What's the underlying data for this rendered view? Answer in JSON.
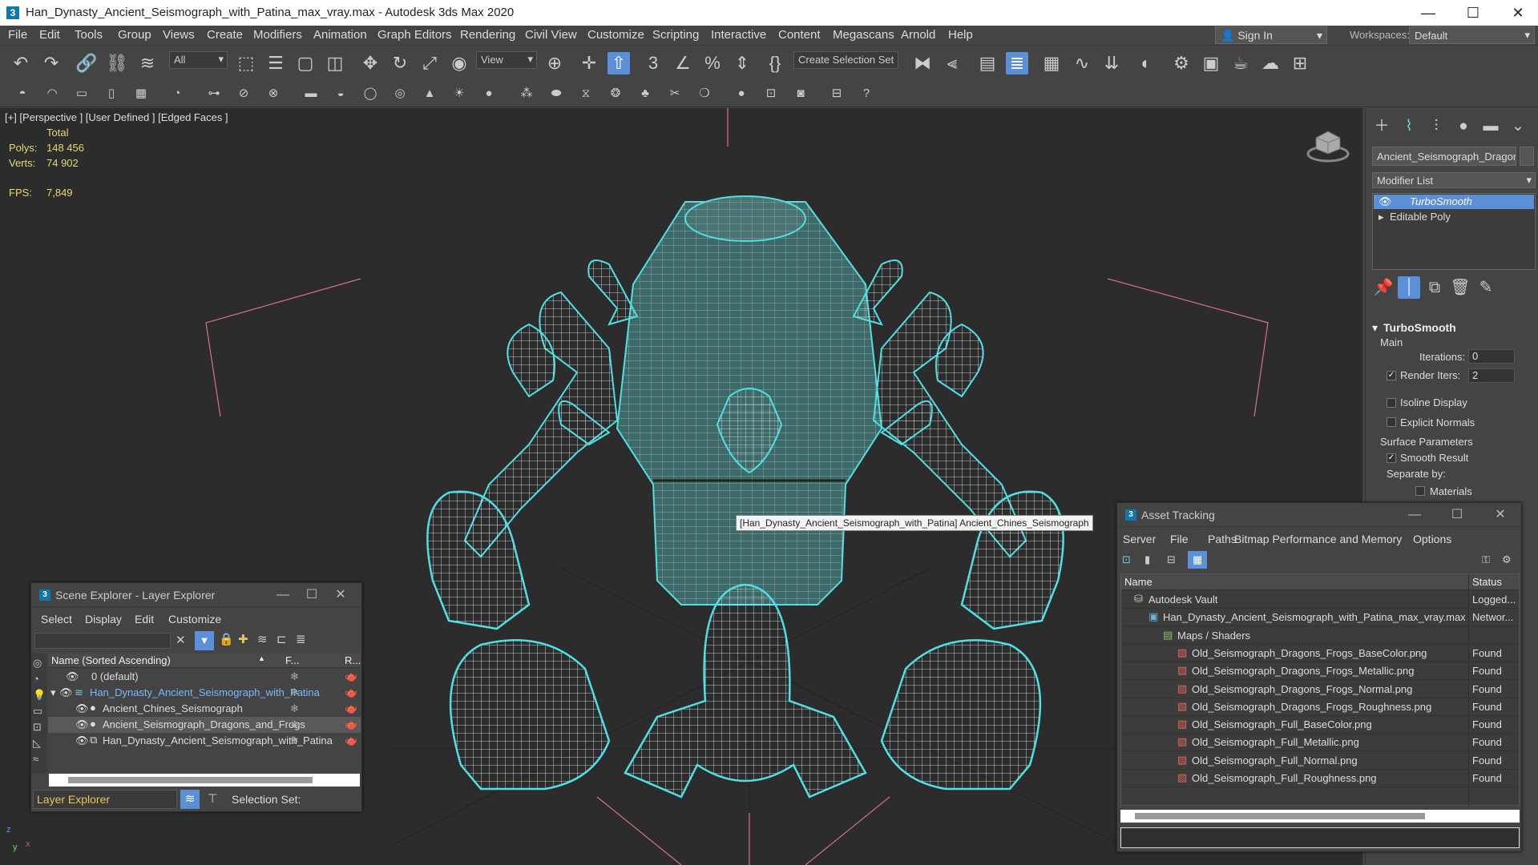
{
  "window": {
    "title": "Han_Dynasty_Ancient_Seismograph_with_Patina_max_vray.max - Autodesk 3ds Max 2020",
    "minimize": "—",
    "maximize": "☐",
    "close": "✕"
  },
  "menu": [
    "File",
    "Edit",
    "Tools",
    "Group",
    "Views",
    "Create",
    "Modifiers",
    "Animation",
    "Graph Editors",
    "Rendering",
    "Civil View",
    "Customize",
    "Scripting",
    "Interactive",
    "Content",
    "Megascans",
    "Arnold",
    "Help"
  ],
  "signin": {
    "label": "Sign In",
    "arrow": "▾"
  },
  "workspaces": {
    "label": "Workspaces:",
    "value": "Default",
    "arrow": "▾"
  },
  "toolbar": {
    "filter_value": "All",
    "refcoord_value": "View",
    "selection_set": "Create Selection Set",
    "snaps_label": "3",
    "dropdown_arrow": "▾"
  },
  "viewport": {
    "label": "[+] [Perspective ] [User Defined ] [Edged Faces ]",
    "stats": {
      "total_label": "Total",
      "polys_label": "Polys:",
      "polys_value": "148 456",
      "verts_label": "Verts:",
      "verts_value": "74 902",
      "fps_label": "FPS:",
      "fps_value": "7,849"
    },
    "tooltip": "[Han_Dynasty_Ancient_Seismograph_with_Patina] Ancient_Chines_Seismograph",
    "colors": {
      "bg": "#2c2c2c",
      "wire": "#e8f6f6",
      "outline": "#4fe0e6",
      "patina": "#3d6a68",
      "bbox": "#d6727d"
    }
  },
  "command_panel": {
    "object_name": "Ancient_Seismograph_Dragons_a",
    "modifier_list": "Modifier List",
    "stack": [
      {
        "label": "TurboSmooth",
        "selected": true,
        "eye": "👁"
      },
      {
        "label": "Editable Poly",
        "selected": false,
        "expander": "▸"
      }
    ],
    "rollout": {
      "title": "TurboSmooth",
      "expander": "▾",
      "main_label": "Main",
      "iterations_label": "Iterations:",
      "iterations_value": "0",
      "render_iters_label": "Render Iters:",
      "render_iters_value": "2",
      "isoline_label": "Isoline Display",
      "explicit_normals_label": "Explicit Normals",
      "surface_params_label": "Surface Parameters",
      "smooth_result_label": "Smooth Result",
      "separate_by_label": "Separate by:",
      "materials_label": "Materials",
      "check": "✓",
      "spin_arrows": "▴▾"
    }
  },
  "scene_explorer": {
    "title": "Scene Explorer - Layer Explorer",
    "menu": [
      "Select",
      "Display",
      "Edit",
      "Customize"
    ],
    "columns": {
      "name": "Name (Sorted Ascending)",
      "sort": "▲",
      "freeze": "F...",
      "render": "R..."
    },
    "rows": [
      {
        "name": "0 (default)",
        "indent": 0,
        "highlight": false,
        "selected": false
      },
      {
        "name": "Han_Dynasty_Ancient_Seismograph_with_Patina",
        "indent": 0,
        "highlight": true,
        "selected": false
      },
      {
        "name": "Ancient_Chines_Seismograph",
        "indent": 1,
        "highlight": false,
        "selected": false
      },
      {
        "name": "Ancient_Seismograph_Dragons_and_Frogs",
        "indent": 1,
        "highlight": false,
        "selected": true
      },
      {
        "name": "Han_Dynasty_Ancient_Seismograph_with_Patina",
        "indent": 1,
        "highlight": false,
        "selected": false
      }
    ],
    "footer_value": "Layer Explorer",
    "selection_set_label": "Selection Set:",
    "clear_icon": "✕",
    "eye_icon": "👁",
    "snow_icon": "❄",
    "teapot_icon": "🫖",
    "expand_icon": "▾"
  },
  "asset_tracking": {
    "title": "Asset Tracking",
    "menu": [
      "Server",
      "File",
      "Paths",
      "Bitmap Performance and Memory",
      "Options"
    ],
    "columns": {
      "name": "Name",
      "status": "Status"
    },
    "rows": [
      {
        "name": "Autodesk Vault",
        "status": "Logged...",
        "indent": 0,
        "icon": "vault"
      },
      {
        "name": "Han_Dynasty_Ancient_Seismograph_with_Patina_max_vray.max",
        "status": "Networ...",
        "indent": 1,
        "icon": "max"
      },
      {
        "name": "Maps / Shaders",
        "status": "",
        "indent": 2,
        "icon": "folder"
      },
      {
        "name": "Old_Seismograph_Dragons_Frogs_BaseColor.png",
        "status": "Found",
        "indent": 3,
        "icon": "png"
      },
      {
        "name": "Old_Seismograph_Dragons_Frogs_Metallic.png",
        "status": "Found",
        "indent": 3,
        "icon": "png"
      },
      {
        "name": "Old_Seismograph_Dragons_Frogs_Normal.png",
        "status": "Found",
        "indent": 3,
        "icon": "png"
      },
      {
        "name": "Old_Seismograph_Dragons_Frogs_Roughness.png",
        "status": "Found",
        "indent": 3,
        "icon": "png"
      },
      {
        "name": "Old_Seismograph_Full_BaseColor.png",
        "status": "Found",
        "indent": 3,
        "icon": "png"
      },
      {
        "name": "Old_Seismograph_Full_Metallic.png",
        "status": "Found",
        "indent": 3,
        "icon": "png"
      },
      {
        "name": "Old_Seismograph_Full_Normal.png",
        "status": "Found",
        "indent": 3,
        "icon": "png"
      },
      {
        "name": "Old_Seismograph_Full_Roughness.png",
        "status": "Found",
        "indent": 3,
        "icon": "png"
      }
    ]
  },
  "axis_gizmo": {
    "x": "x",
    "y": "y",
    "z": "z"
  }
}
